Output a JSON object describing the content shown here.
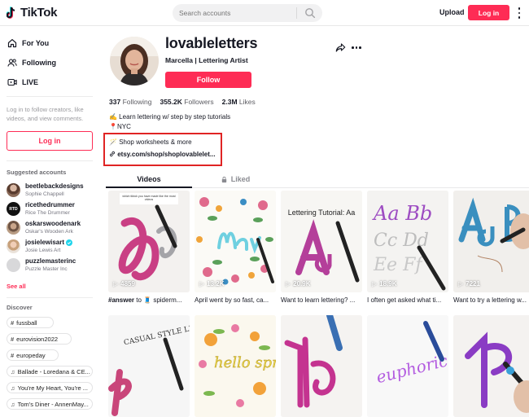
{
  "header": {
    "logo_text": "TikTok",
    "search_placeholder": "Search accounts",
    "upload_label": "Upload",
    "login_label": "Log in"
  },
  "sidebar": {
    "nav": [
      {
        "label": "For You",
        "icon": "home-icon"
      },
      {
        "label": "Following",
        "icon": "users-icon"
      },
      {
        "label": "LIVE",
        "icon": "live-icon"
      }
    ],
    "login_prompt": "Log in to follow creators, like videos, and view comments.",
    "login_button": "Log in",
    "suggested_heading": "Suggested accounts",
    "accounts": [
      {
        "username": "beetlebackdesigns",
        "name": "Sophie Chappell",
        "verified": false
      },
      {
        "username": "ricethedrummer",
        "name": "Rice The Drummer",
        "verified": false
      },
      {
        "username": "oskarswoodenark",
        "name": "Oskar's Wooden Ark",
        "verified": false
      },
      {
        "username": "josielewisart",
        "name": "Josie Lewis Art",
        "verified": true
      },
      {
        "username": "puzzlemasterinc",
        "name": "Puzzle Master Inc",
        "verified": false
      }
    ],
    "see_all": "See all",
    "discover_heading": "Discover",
    "discover": [
      {
        "icon": "#",
        "label": "fussball"
      },
      {
        "icon": "#",
        "label": "eurovision2022"
      },
      {
        "icon": "#",
        "label": "europeday"
      },
      {
        "icon": "♫",
        "label": "Ballade - Loredana & CE..."
      },
      {
        "icon": "♫",
        "label": "You're My Heart, You're ..."
      },
      {
        "icon": "♫",
        "label": "Tom's Diner - AnnenMay..."
      }
    ]
  },
  "profile": {
    "username": "lovableletters",
    "display_name": "Marcella | Lettering Artist",
    "follow_label": "Follow",
    "stats": {
      "following_count": "337",
      "following_label": "Following",
      "followers_count": "355.2K",
      "followers_label": "Followers",
      "likes_count": "2.3M",
      "likes_label": "Likes"
    },
    "bio_line1": "✍️ Learn lettering w/ step by step tutorials",
    "bio_line2": "📍NYC",
    "link_line1": "Shop worksheets & more",
    "link_line2": "etsy.com/shop/shoplovablelet..."
  },
  "tabs": [
    {
      "label": "Videos",
      "active": true
    },
    {
      "label": "Liked",
      "active": false,
      "icon": "lock-icon"
    }
  ],
  "videos": [
    {
      "views": "4859",
      "caption_tag": "#answer",
      "caption_rest": " to 🧵 spiderm...",
      "thumb_text": "which tiktok you have made like the most videos"
    },
    {
      "views": "13.2K",
      "caption_tag": "",
      "caption_rest": "April went by so fast, ca...",
      "thumb_text": "May"
    },
    {
      "views": "20.9K",
      "caption_tag": "",
      "caption_rest": "Want to learn lettering? ...",
      "thumb_text": "Lettering Tutorial: Aa"
    },
    {
      "views": "18.9K",
      "caption_tag": "",
      "caption_rest": "I often get asked what ti...",
      "thumb_text": "Aa Bb"
    },
    {
      "views": "7221",
      "caption_tag": "",
      "caption_rest": "Want to try a lettering w...",
      "thumb_text": "Aa B"
    },
    {
      "views": "",
      "caption_tag": "",
      "caption_rest": "",
      "thumb_text": "CASUAL STYLE LETTERS"
    },
    {
      "views": "",
      "caption_tag": "",
      "caption_rest": "",
      "thumb_text": "hello spring"
    },
    {
      "views": "",
      "caption_tag": "",
      "caption_rest": "",
      "thumb_text": ""
    },
    {
      "views": "",
      "caption_tag": "",
      "caption_rest": "",
      "thumb_text": "euphoric"
    },
    {
      "views": "",
      "caption_tag": "",
      "caption_rest": "",
      "thumb_text": ""
    }
  ],
  "colors": {
    "brand": "#fe2c55",
    "highlight": "#e02424",
    "verified": "#20d5ec"
  }
}
